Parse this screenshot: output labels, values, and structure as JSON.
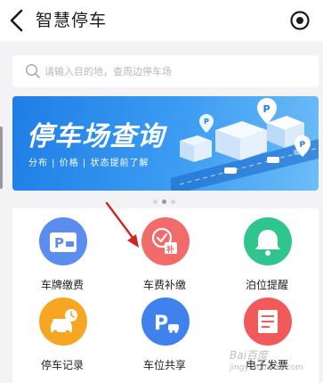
{
  "header": {
    "title": "智慧停车",
    "back_icon": "chevron-left-icon",
    "target_icon": "target-icon"
  },
  "search": {
    "placeholder": "请输入目的地，查周边停车场",
    "icon": "search-icon"
  },
  "banner": {
    "title": "停车场查询",
    "subtitle": "分布 | 价格 | 状态提前了解"
  },
  "carousel": {
    "count": 3,
    "active": 1
  },
  "services": [
    {
      "label": "车牌缴费",
      "icon": "license-plate-p-icon",
      "color": "#5b8def"
    },
    {
      "label": "车费补缴",
      "icon": "fee-supplement-icon",
      "color": "#f26b6b"
    },
    {
      "label": "泊位提醒",
      "icon": "bell-icon",
      "color": "#2fc58e"
    },
    {
      "label": "停车记录",
      "icon": "car-clock-icon",
      "color": "#f6a623"
    },
    {
      "label": "车位共享",
      "icon": "parking-share-icon",
      "color": "#3f82ee"
    },
    {
      "label": "电子发票",
      "icon": "invoice-icon",
      "color": "#f15a5a"
    }
  ],
  "watermark": {
    "text": "Bai百度",
    "sub": "jingyan.baidu.com"
  },
  "colors": {
    "accent": "#1e7ee6",
    "annotation_arrow": "#d22222"
  }
}
